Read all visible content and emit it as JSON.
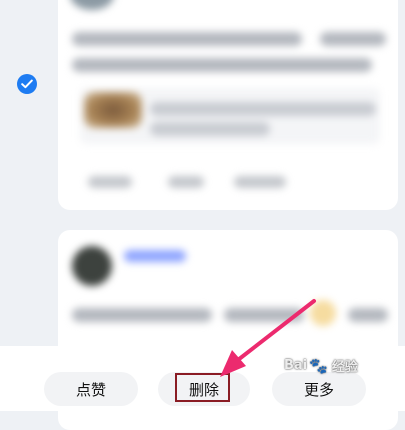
{
  "selection": {
    "checkmark": "✓",
    "color": "#1e7cf2"
  },
  "actions": {
    "like_label": "点赞",
    "delete_label": "删除",
    "more_label": "更多"
  },
  "watermark": {
    "brand_prefix": "Bai",
    "brand_suffix": "经验"
  },
  "annotation": {
    "highlight_color": "#8a1c24",
    "arrow_color": "#ec2a6e"
  }
}
